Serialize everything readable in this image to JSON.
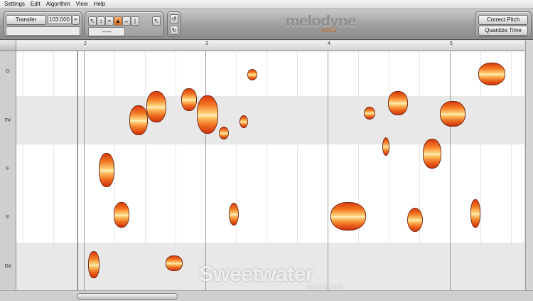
{
  "menu": [
    "Settings",
    "Edit",
    "Algorithm",
    "View",
    "Help"
  ],
  "toolbar": {
    "transfer_label": "Transfer",
    "tempo_value": "103.000",
    "pitch_tool_field": "-----",
    "correct_pitch_label": "Correct Pitch",
    "quantize_time_label": "Quantize Time"
  },
  "logo": {
    "name": "melodyne",
    "edition": "editor"
  },
  "pitch_lanes": [
    "G",
    "F#",
    "F",
    "E",
    "D#"
  ],
  "bar_numbers": [
    "2",
    "3",
    "4",
    "5"
  ],
  "watermark": {
    "text": "Sweetwater",
    "sub": "sweetwater.com"
  },
  "colors": {
    "note_hot": "#d83a10",
    "note_center": "#fff0c0",
    "lane_alt": "#e8e8e8"
  }
}
